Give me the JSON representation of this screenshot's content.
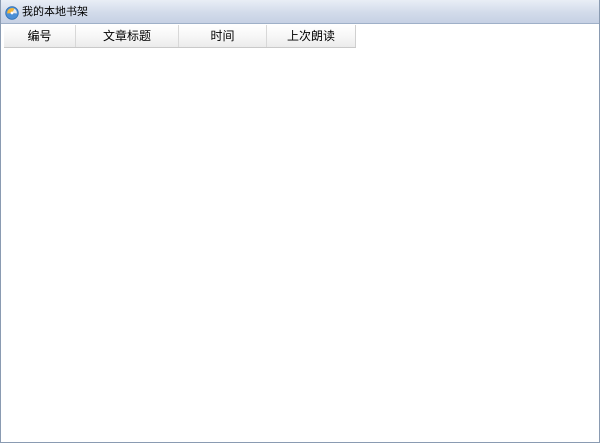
{
  "window": {
    "title": "我的本地书架",
    "app_icon": "bookshelf-app-icon"
  },
  "list": {
    "columns": [
      {
        "label": "编号"
      },
      {
        "label": "文章标题"
      },
      {
        "label": "时间"
      },
      {
        "label": "上次朗读"
      }
    ],
    "rows": []
  },
  "colors": {
    "titlebar_top": "#e9eef6",
    "titlebar_bottom": "#c6d1e4",
    "header_bg": "#f6f6f6",
    "background": "#ffffff"
  }
}
